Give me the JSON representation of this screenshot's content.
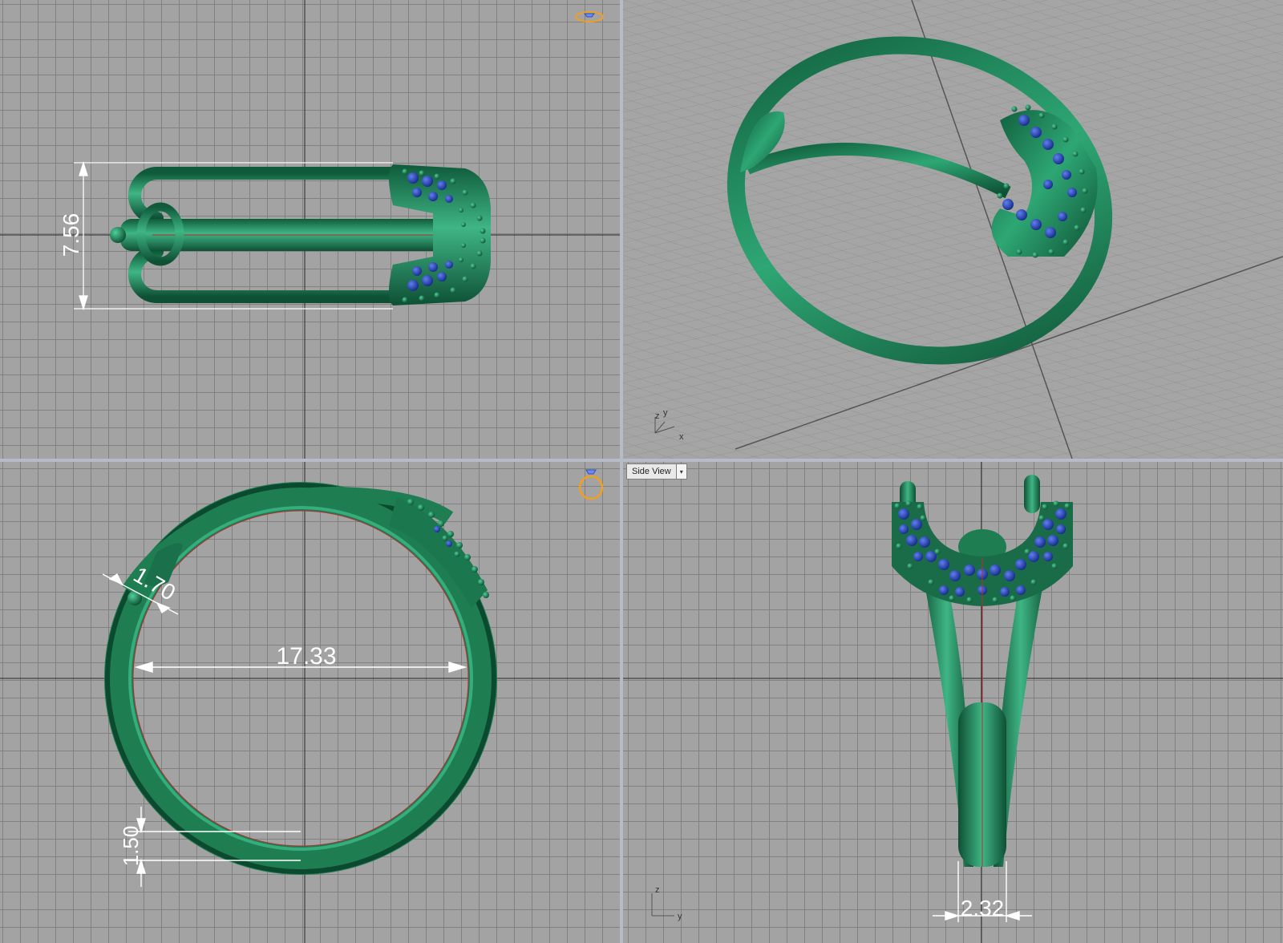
{
  "viewports": {
    "top_left": {
      "dimension_height": "7.56"
    },
    "top_right": {
      "axis_x": "x",
      "axis_y": "y",
      "axis_z": "z"
    },
    "bottom_left": {
      "dimension_width": "1.70",
      "dimension_diameter": "17.33",
      "dimension_thickness": "1.50"
    },
    "bottom_right": {
      "view_tab_label": "Side View",
      "view_tab_arrow": "▾",
      "axis_y": "y",
      "axis_z": "z",
      "dimension_width": "2.32"
    }
  },
  "icons": {
    "ring_top_icon": "ring-with-gem-top-icon",
    "ring_side_icon": "ring-with-gem-side-icon"
  },
  "colors": {
    "ring_metal": "#1f8a5b",
    "gemstone": "#1f3fa8",
    "viewport_bg": "#a3a3a3",
    "grid_line": "#7d7d7d",
    "dimension_line": "#ffffff",
    "icon_accent": "#f0a020"
  }
}
